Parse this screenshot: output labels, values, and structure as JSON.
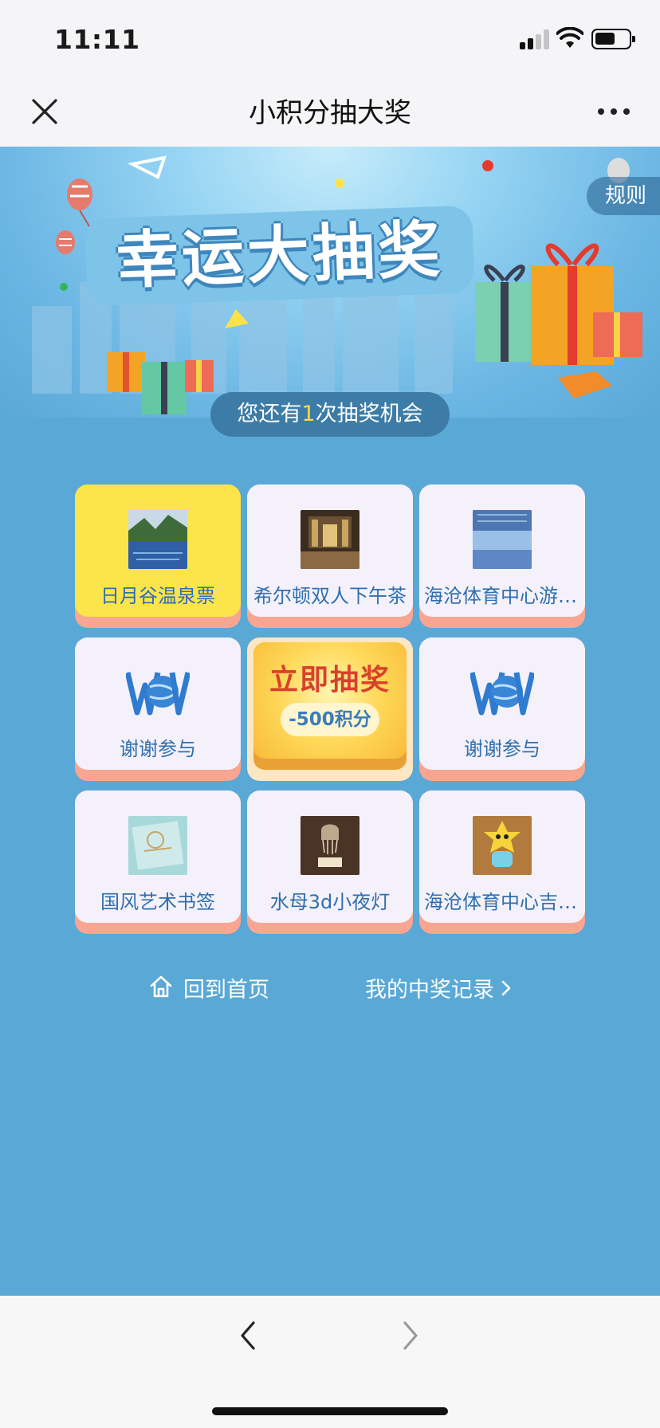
{
  "status_bar": {
    "time": "11:11"
  },
  "nav": {
    "title": "小积分抽大奖"
  },
  "banner": {
    "title": "幸运大抽奖",
    "rules_label": "规则",
    "chances_prefix": "您还有",
    "chances_count": "1",
    "chances_suffix": "次抽奖机会"
  },
  "grid": {
    "prizes": [
      {
        "label": "日月谷温泉票",
        "image": "hot-spring-photo",
        "active": true
      },
      {
        "label": "希尔顿双人下午茶",
        "image": "hotel-lobby-photo"
      },
      {
        "label": "海沧体育中心游泳票",
        "image": "stadium-photo"
      },
      {
        "label": "谢谢参与",
        "image": "won-logo"
      },
      {
        "label": "谢谢参与",
        "image": "won-logo"
      },
      {
        "label": "国风艺术书签",
        "image": "bookmark-photo"
      },
      {
        "label": "水母3d小夜灯",
        "image": "night-lamp-photo"
      },
      {
        "label": "海沧体育中心吉祥物",
        "image": "mascot-photo"
      }
    ],
    "draw_button": {
      "label": "立即抽奖",
      "cost": "-500积分"
    }
  },
  "links": {
    "home": "回到首页",
    "records": "我的中奖记录"
  },
  "colors": {
    "main_bg": "#5aa8d6",
    "card_bg": "#f4f1fb",
    "card_active": "#fbe54a",
    "card_shadow": "#f8a592",
    "text_blue": "#2f6fb0",
    "draw_red": "#d8412c"
  }
}
